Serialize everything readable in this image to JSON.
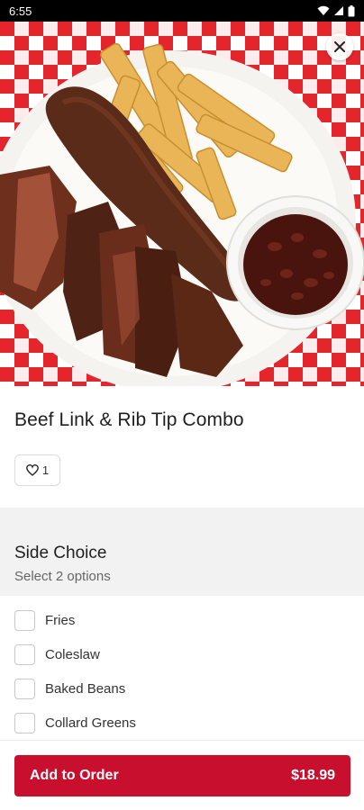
{
  "status_bar": {
    "time": "6:55"
  },
  "hero": {
    "image": "bbq-plate-photo",
    "close_icon": "close-icon"
  },
  "item": {
    "title": "Beef Link & Rib Tip Combo",
    "likes": "1"
  },
  "side_choice": {
    "title": "Side Choice",
    "subtitle": "Select 2 options",
    "options": [
      {
        "label": "Fries"
      },
      {
        "label": "Coleslaw"
      },
      {
        "label": "Baked Beans"
      },
      {
        "label": "Collard Greens"
      }
    ]
  },
  "footer": {
    "button_label": "Add to Order",
    "price": "$18.99"
  },
  "colors": {
    "accent": "#c8102e",
    "checker": "#e4252c"
  }
}
